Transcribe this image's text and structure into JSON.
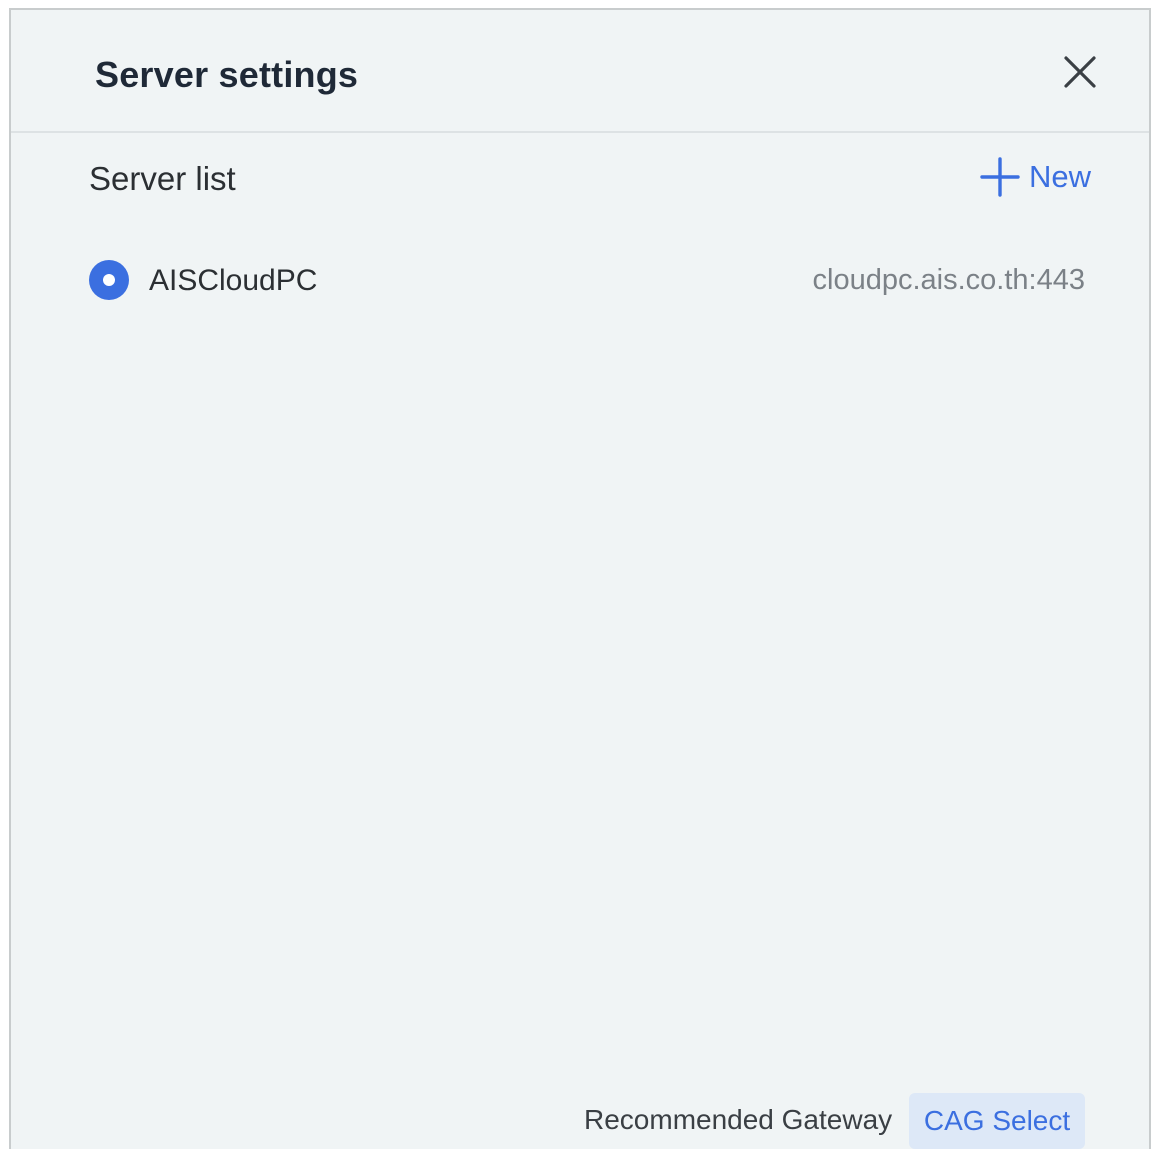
{
  "dialog": {
    "title": "Server settings",
    "close_icon": "close-icon"
  },
  "server_list": {
    "label": "Server list",
    "new_button": {
      "icon": "plus-icon",
      "label": "New"
    },
    "items": [
      {
        "name": "AISCloudPC",
        "address": "cloudpc.ais.co.th:443",
        "selected": true
      }
    ]
  },
  "footer": {
    "recommended_gateway_label": "Recommended Gateway",
    "cag_select_label": "CAG Select"
  },
  "colors": {
    "accent": "#3b6fe0",
    "background": "#f0f4f5",
    "cag_button_bg": "#dde8f7"
  }
}
